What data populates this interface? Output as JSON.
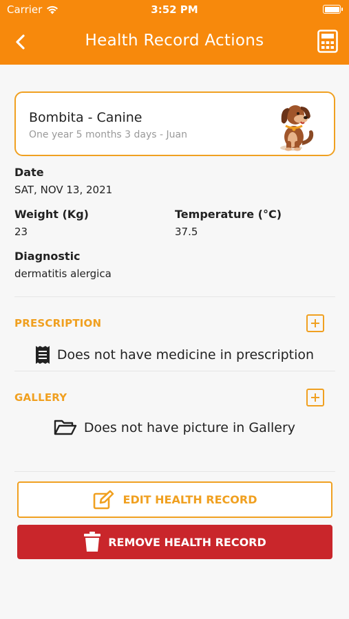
{
  "status_bar": {
    "carrier": "Carrier",
    "time": "3:52 PM"
  },
  "nav": {
    "title": "Health Record Actions"
  },
  "pet": {
    "name": "Bombita - Canine",
    "details": "One year 5 months 3 days - Juan"
  },
  "record": {
    "date_label": "Date",
    "date_value": "SAT, NOV 13, 2021",
    "weight_label": "Weight (Kg)",
    "weight_value": "23",
    "temperature_label": "Temperature (°C)",
    "temperature_value": "37.5",
    "diagnostic_label": "Diagnostic",
    "diagnostic_value": "dermatitis alergica"
  },
  "prescription": {
    "title": "PRESCRIPTION",
    "empty_message": "Does not have medicine in prescription"
  },
  "gallery": {
    "title": "GALLERY",
    "empty_message": "Does not have picture in Gallery"
  },
  "actions": {
    "edit_label": "EDIT HEALTH RECORD",
    "remove_label": "REMOVE HEALTH RECORD"
  },
  "colors": {
    "primary": "#f7890c",
    "accent": "#f0a020",
    "danger": "#c9262b",
    "background": "#f7f7f7"
  }
}
